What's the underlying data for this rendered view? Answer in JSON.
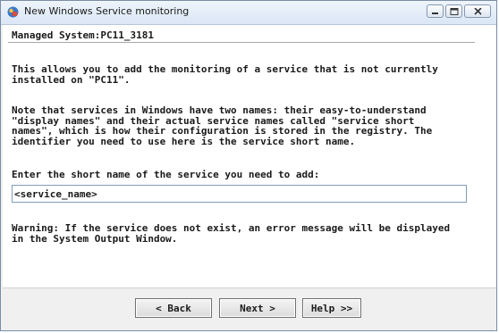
{
  "window": {
    "title": "New Windows Service monitoring",
    "minimize_icon": "minimize-icon",
    "maximize_icon": "maximize-icon",
    "close_icon": "close-icon",
    "app_icon": "app-icon"
  },
  "header": {
    "managed_system": "Managed System:PC11_3181"
  },
  "body": {
    "para1": "This allows you to add the monitoring of a service that is not currently\ninstalled on \"PC11\".",
    "para2": "Note that services in Windows have two names: their easy-to-understand\n\"display names\" and their actual service names called \"service short\nnames\", which is how their configuration is stored in the registry. The\nidentifier you need to use here is the service short name.",
    "input_label": "Enter the short name of the service you need to add:",
    "input_value": "<service_name>",
    "warning": "Warning: If the service does not exist, an error message will be displayed\nin the System Output Window."
  },
  "buttons": {
    "back": "< Back",
    "next": "Next >",
    "help": "Help >>"
  },
  "colors": {
    "titlebar": "#dbe7f5",
    "window_border": "#7a8ca5",
    "input_border": "#7f9db9"
  }
}
